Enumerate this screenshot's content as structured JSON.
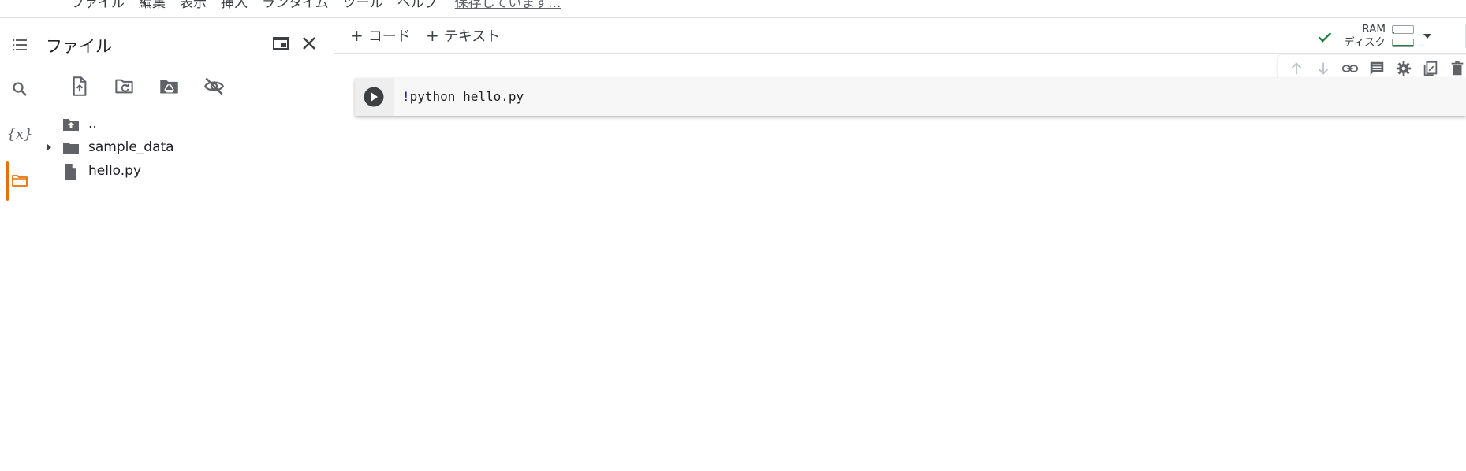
{
  "menu": {
    "items": [
      "ファイル",
      "編集",
      "表示",
      "挿入",
      "ランタイム",
      "ツール",
      "ヘルプ"
    ],
    "status_link": "保存しています..."
  },
  "sidebar": {
    "icons": [
      "table-of-contents-icon",
      "search-icon",
      "variables-icon",
      "folder-icon"
    ],
    "variables_glyph": "{x}",
    "active": "folder-icon"
  },
  "files_panel": {
    "title": "ファイル",
    "toolbar": [
      "upload-file-icon",
      "refresh-folder-icon",
      "mount-drive-icon",
      "hide-hidden-files-icon"
    ],
    "tree": [
      {
        "label": "..",
        "icon": "folder-up-icon",
        "expandable": false
      },
      {
        "label": "sample_data",
        "icon": "folder-icon",
        "expandable": true
      },
      {
        "label": "hello.py",
        "icon": "file-icon",
        "expandable": false
      }
    ]
  },
  "notebook_toolbar": {
    "add_code": "コード",
    "add_text": "テキスト",
    "resources": {
      "ram_label": "RAM",
      "disk_label": "ディスク",
      "connected": true,
      "status_color": "#188038"
    }
  },
  "cell": {
    "code_prefix": "!",
    "code_rest": "python hello.py"
  },
  "cell_toolbar": [
    "move-up-icon",
    "move-down-icon",
    "link-icon",
    "comment-icon",
    "settings-icon",
    "mirror-cell-icon",
    "delete-icon"
  ],
  "colors": {
    "accent": "#e8710a",
    "icon": "#5f6368",
    "border": "#e0e0e0"
  }
}
